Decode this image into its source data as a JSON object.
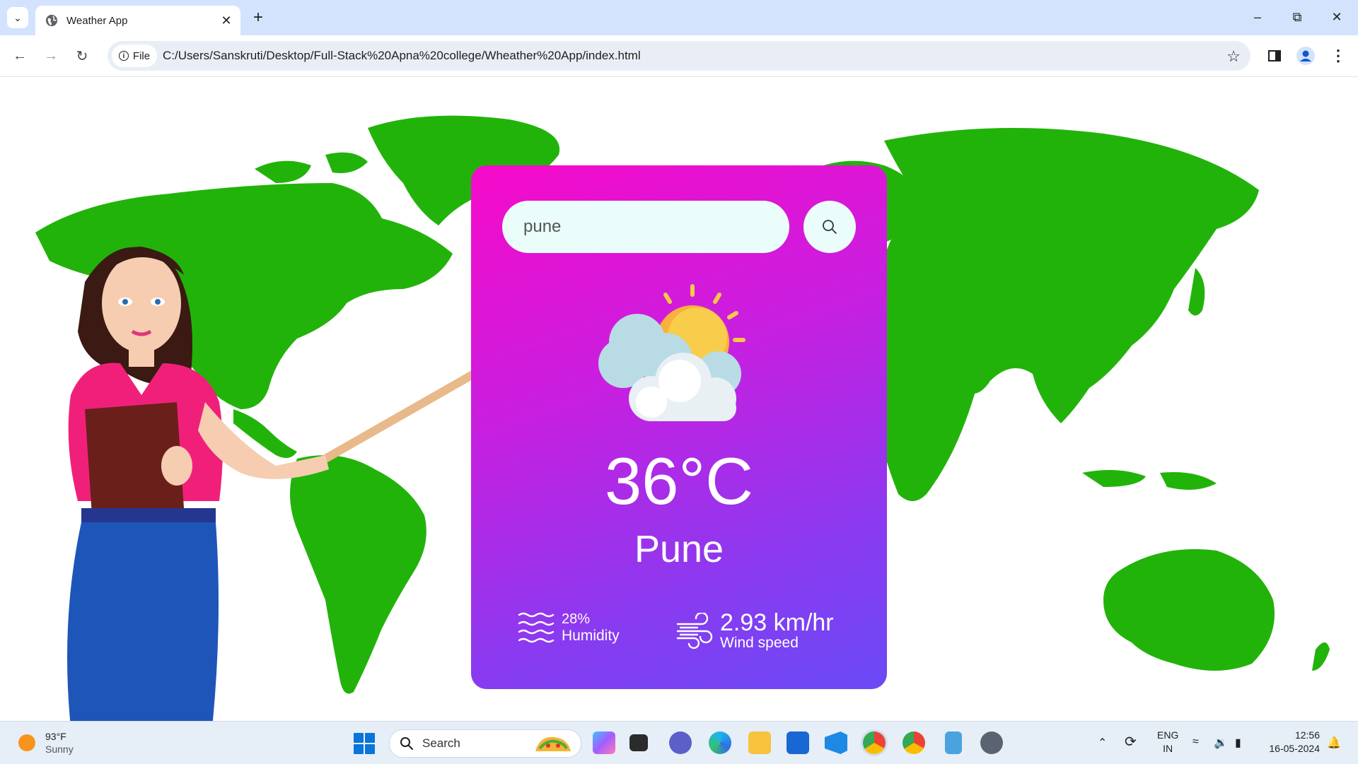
{
  "browser": {
    "tab_title": "Weather App",
    "file_label": "File",
    "url": "C:/Users/Sanskruti/Desktop/Full-Stack%20Apna%20college/Wheather%20App/index.html"
  },
  "weather_app": {
    "search_value": "pune",
    "temperature": "36°C",
    "city": "Pune",
    "humidity_value": "28%",
    "humidity_label": "Humidity",
    "wind_value": "2.93 km/hr",
    "wind_label": "Wind speed",
    "icon": "partly-cloudy-sun-icon"
  },
  "taskbar": {
    "weather_temp": "93°F",
    "weather_desc": "Sunny",
    "search_label": "Search",
    "lang_top": "ENG",
    "lang_bottom": "IN",
    "time": "12:56",
    "date": "16-05-2024"
  },
  "colors": {
    "card_gradient_start": "#f70ac9",
    "card_gradient_end": "#6a4af5",
    "map_green": "#22b30a",
    "chrome_tabstrip": "#d3e3fd"
  }
}
